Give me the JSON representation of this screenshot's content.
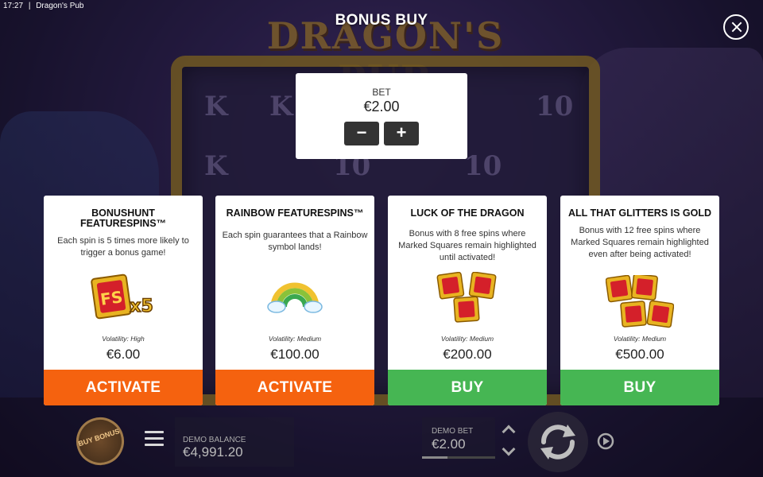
{
  "status": {
    "time": "17:27",
    "separator": "|",
    "app_name": "Dragon's Pub"
  },
  "background": {
    "logo_text": "DRAGON'S PUB",
    "reel_symbols": [
      "K",
      "K",
      "10",
      "K",
      "10",
      "10"
    ]
  },
  "dialog": {
    "title": "BONUS BUY"
  },
  "bet": {
    "label": "BET",
    "value": "€2.00",
    "minus": "−",
    "plus": "+"
  },
  "cards": [
    {
      "title": "BONUSHUNT FEATURESPINS™",
      "description": "Each spin is 5 times more likely to trigger a bonus game!",
      "art_icon": "fs-x5-badge-icon",
      "art_text": "x5",
      "volatility": "Volatility: High",
      "price": "€6.00",
      "action": "ACTIVATE",
      "action_color": "#f5620f"
    },
    {
      "title": "RAINBOW FEATURESPINS™",
      "description": "Each spin guarantees that a Rainbow symbol lands!",
      "art_icon": "rainbow-icon",
      "volatility": "Volatility: Medium",
      "price": "€100.00",
      "action": "ACTIVATE",
      "action_color": "#f5620f"
    },
    {
      "title": "LUCK OF THE DRAGON",
      "description": "Bonus with 8 free spins where Marked Squares remain highlighted until activated!",
      "art_icon": "three-badges-icon",
      "volatility": "Volatility: Medium",
      "price": "€200.00",
      "action": "BUY",
      "action_color": "#46b653"
    },
    {
      "title": "ALL THAT GLITTERS IS GOLD",
      "description": "Bonus with 12 free spins where Marked Squares remain highlighted even after being activated!",
      "art_icon": "four-badges-icon",
      "volatility": "Volatility: Medium",
      "price": "€500.00",
      "action": "BUY",
      "action_color": "#46b653"
    }
  ],
  "bottombar": {
    "buy_bonus_label": "BUY BONUS",
    "balance_label": "DEMO BALANCE",
    "balance_value": "€4,991.20",
    "bet_label": "DEMO BET",
    "bet_value": "€2.00"
  },
  "colors": {
    "activate": "#f5620f",
    "buy": "#46b653",
    "badge_gold": "#e8b321",
    "badge_red": "#d4202a"
  }
}
